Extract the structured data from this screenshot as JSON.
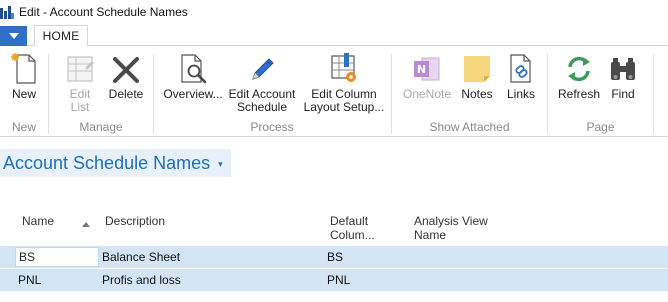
{
  "window": {
    "title": "Edit - Account Schedule Names"
  },
  "ribbon_tabs": [
    {
      "label": "HOME"
    }
  ],
  "ribbon": {
    "groups": [
      {
        "label": "New",
        "buttons": [
          {
            "label": "New",
            "icon": "new-document-icon"
          }
        ]
      },
      {
        "label": "Manage",
        "buttons": [
          {
            "label": "Edit\nList",
            "icon": "edit-list-icon",
            "disabled": true
          },
          {
            "label": "Delete",
            "icon": "delete-x-icon"
          }
        ]
      },
      {
        "label": "Process",
        "buttons": [
          {
            "label": "Overview...",
            "icon": "overview-magnifier-icon"
          },
          {
            "label": "Edit Account\nSchedule",
            "icon": "pencil-icon"
          },
          {
            "label": "Edit Column\nLayout Setup...",
            "icon": "column-layout-gear-icon"
          }
        ]
      },
      {
        "label": "Show Attached",
        "buttons": [
          {
            "label": "OneNote",
            "icon": "onenote-icon",
            "disabled": true
          },
          {
            "label": "Notes",
            "icon": "notes-icon"
          },
          {
            "label": "Links",
            "icon": "links-icon"
          }
        ]
      },
      {
        "label": "Page",
        "buttons": [
          {
            "label": "Refresh",
            "icon": "refresh-icon"
          },
          {
            "label": "Find",
            "icon": "binoculars-icon"
          }
        ]
      }
    ]
  },
  "page": {
    "title": "Account Schedule Names"
  },
  "table": {
    "columns": [
      {
        "label": "Name"
      },
      {
        "label": "Description"
      },
      {
        "label": "Default\nColum..."
      },
      {
        "label": "Analysis View\nName"
      }
    ],
    "rows": [
      {
        "name": "BS",
        "description": "Balance Sheet",
        "default_column": "BS",
        "analysis_view": ""
      },
      {
        "name": "PNL",
        "description": "Profis and loss",
        "default_column": "PNL",
        "analysis_view": ""
      }
    ]
  },
  "colors": {
    "accent": "#1d6fb8",
    "app_menu": "#2f6fc6",
    "selected_row": "#d3e5f5",
    "title_bg": "#e8f1fa"
  }
}
